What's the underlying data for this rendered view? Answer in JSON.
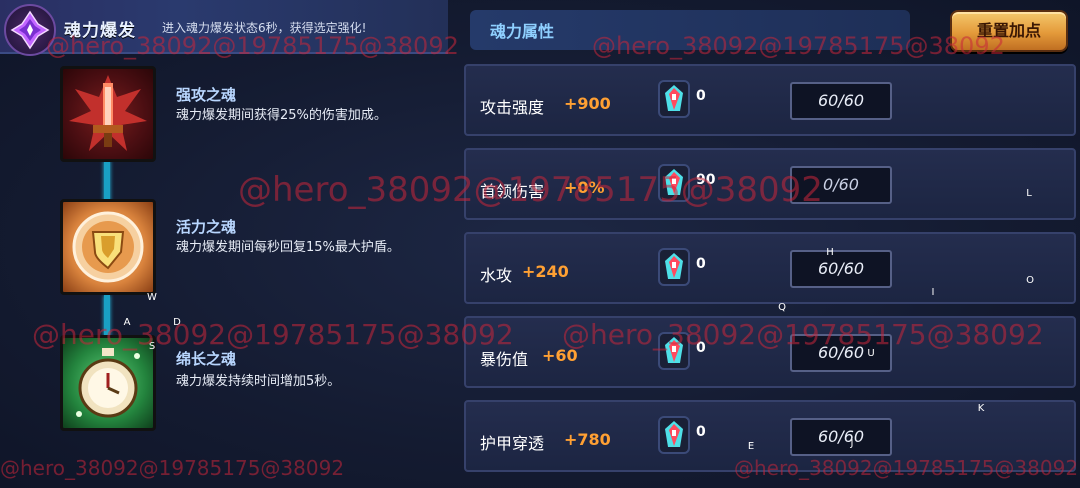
{
  "burst": {
    "title": "魂力爆发",
    "description": "进入魂力爆发状态6秒，获得选定强化!",
    "icon": "soul-burst-crystal-icon"
  },
  "souls": [
    {
      "name": "强攻之魂",
      "description": "魂力爆发期间获得25%的伤害加成。",
      "icon": "sword-emblem-icon"
    },
    {
      "name": "活力之魂",
      "description": "魂力爆发期间每秒回复15%最大护盾。",
      "icon": "shield-emblem-icon"
    },
    {
      "name": "绵长之魂",
      "description": "魂力爆发持续时间增加5秒。",
      "icon": "stopwatch-emblem-icon"
    }
  ],
  "attributes": {
    "title": "魂力属性",
    "reset_label": "重置加点",
    "rows": [
      {
        "name": "攻击强度",
        "bonus": "+900",
        "gems": "0",
        "points": "60/60"
      },
      {
        "name": "首领伤害",
        "bonus": "+0%",
        "gems": "90",
        "points": "0/60"
      },
      {
        "name": "水攻",
        "bonus": "+240",
        "gems": "0",
        "points": "60/60"
      },
      {
        "name": "暴伤值",
        "bonus": "+60",
        "gems": "0",
        "points": "60/60"
      },
      {
        "name": "护甲穿透",
        "bonus": "+780",
        "gems": "0",
        "points": "60/60"
      }
    ]
  },
  "key_hints": [
    "W",
    "A",
    "D",
    "S",
    "H",
    "Q",
    "I",
    "L",
    "O",
    "U",
    "K",
    "E",
    "J"
  ],
  "watermark": "@hero_38092@19785175@38092",
  "colors": {
    "accent_orange": "#ffa033",
    "connector_cyan": "#19a0c4",
    "title_blue": "#8fd0ff",
    "watermark_red": "#c8263a"
  }
}
